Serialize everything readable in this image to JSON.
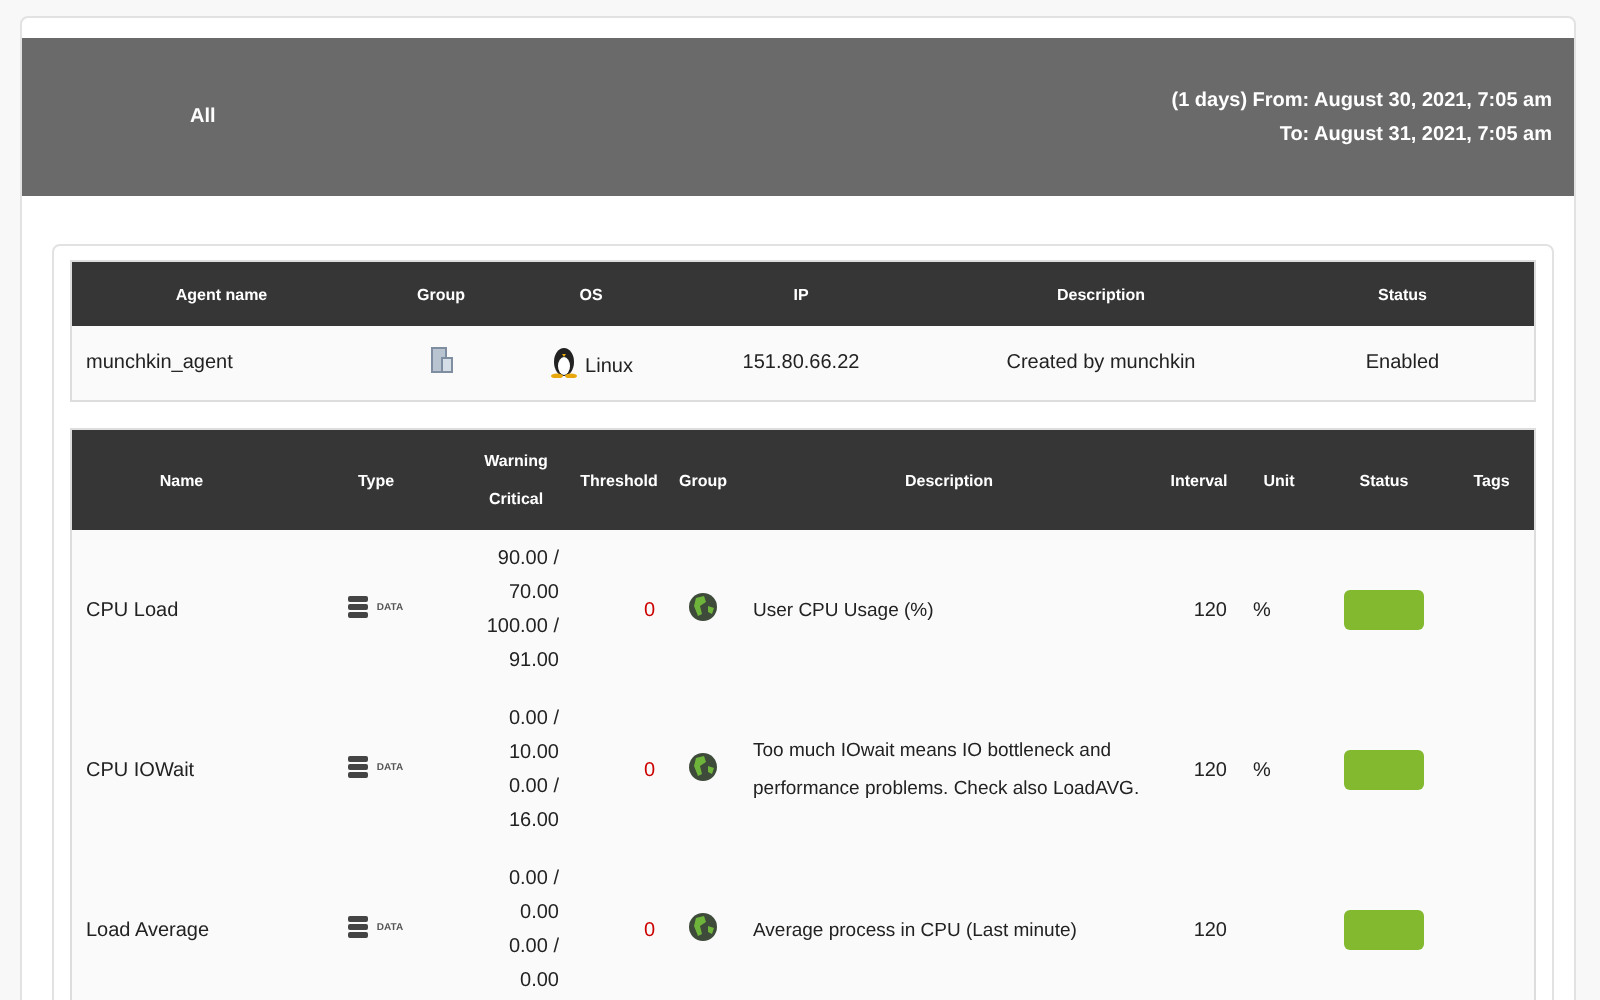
{
  "header": {
    "group": "All",
    "range": "(1 days) From: August 30, 2021, 7:05 am",
    "to": "To: August 31, 2021, 7:05 am"
  },
  "agent_table": {
    "columns": [
      "Agent name",
      "Group",
      "OS",
      "IP",
      "Description",
      "Status"
    ],
    "row": {
      "name": "munchkin_agent",
      "os": "Linux",
      "ip": "151.80.66.22",
      "description": "Created by munchkin",
      "status": "Enabled"
    }
  },
  "monitor_table": {
    "columns": {
      "name": "Name",
      "type": "Type",
      "warning": "Warning",
      "critical": "Critical",
      "threshold": "Threshold",
      "group": "Group",
      "description": "Description",
      "interval": "Interval",
      "unit": "Unit",
      "status": "Status",
      "tags": "Tags"
    },
    "rows": [
      {
        "name": "CPU Load",
        "type_label": "DATA",
        "limits": [
          "90.00 /",
          "70.00",
          "100.00 /",
          "91.00"
        ],
        "threshold": "0",
        "description": "User CPU Usage (%)",
        "interval": "120",
        "unit": "%",
        "color": "#82b92e"
      },
      {
        "name": "CPU IOWait",
        "type_label": "DATA",
        "limits": [
          "0.00 /",
          "10.00",
          "0.00 /",
          "16.00"
        ],
        "threshold": "0",
        "description": "Too much IOwait means IO bottleneck and performance problems. Check also LoadAVG.",
        "interval": "120",
        "unit": "%",
        "color": "#82b92e"
      },
      {
        "name": "Load Average",
        "type_label": "DATA",
        "limits": [
          "0.00 /",
          "0.00",
          "0.00 /",
          "0.00"
        ],
        "threshold": "0",
        "description": "Average process in CPU (Last minute)",
        "interval": "120",
        "color": "#82b92e"
      }
    ]
  }
}
